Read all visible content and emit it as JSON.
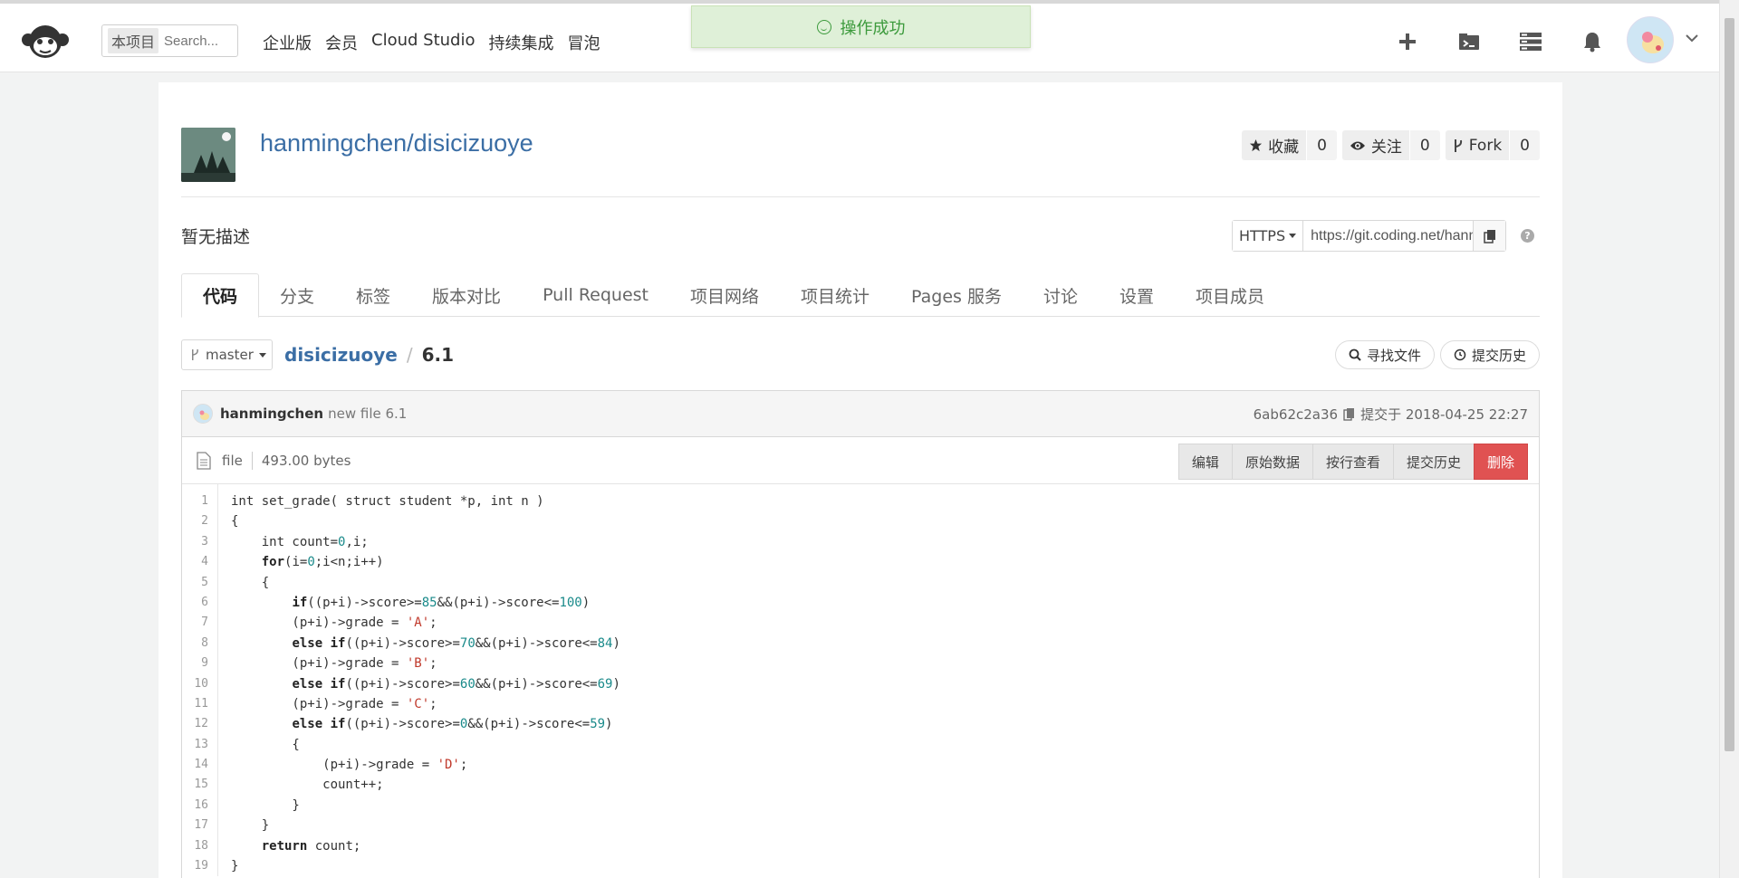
{
  "topbar": {
    "search_scope": "本项目",
    "search_placeholder": "Search...",
    "nav": [
      "企业版",
      "会员",
      "Cloud Studio",
      "持续集成",
      "冒泡"
    ],
    "icons": [
      "plus-icon",
      "terminal-icon",
      "server-icon",
      "bell-icon"
    ]
  },
  "toast": {
    "text": "操作成功"
  },
  "repo": {
    "title": "hanmingchen/disicizuoye",
    "description": "暂无描述",
    "stats": [
      {
        "label": "收藏",
        "count": "0",
        "icon": "star-icon"
      },
      {
        "label": "关注",
        "count": "0",
        "icon": "eye-icon"
      },
      {
        "label": "Fork",
        "count": "0",
        "icon": "fork-icon"
      }
    ],
    "clone": {
      "protocol": "HTTPS",
      "url": "https://git.coding.net/hanmingchen/disicizuoye.git"
    }
  },
  "tabs": [
    "代码",
    "分支",
    "标签",
    "版本对比",
    "Pull Request",
    "项目网络",
    "项目统计",
    "Pages 服务",
    "讨论",
    "设置",
    "项目成员"
  ],
  "breadcrumb": {
    "branch": "master",
    "repo": "disicizuoye",
    "file": "6.1"
  },
  "pills": {
    "find": "寻找文件",
    "history": "提交历史"
  },
  "commit": {
    "author": "hanmingchen",
    "message": "new file 6.1",
    "hash": "6ab62c2a36",
    "time": "提交于 2018-04-25 22:27"
  },
  "file": {
    "type": "file",
    "size": "493.00 bytes",
    "actions": [
      "编辑",
      "原始数据",
      "按行查看",
      "提交历史",
      "删除"
    ]
  },
  "code_lines": [
    "int set_grade( struct student *p, int n )",
    "{",
    "    int count=0,i;",
    "    for(i=0;i<n;i++)",
    "    {",
    "        if((p+i)->score>=85&&(p+i)->score<=100)",
    "        (p+i)->grade = 'A';",
    "        else if((p+i)->score>=70&&(p+i)->score<=84)",
    "        (p+i)->grade = 'B';",
    "        else if((p+i)->score>=60&&(p+i)->score<=69)",
    "        (p+i)->grade = 'C';",
    "        else if((p+i)->score>=0&&(p+i)->score<=59)",
    "        {",
    "            (p+i)->grade = 'D';",
    "            count++;",
    "        }",
    "    }",
    "    return count;",
    "}"
  ]
}
